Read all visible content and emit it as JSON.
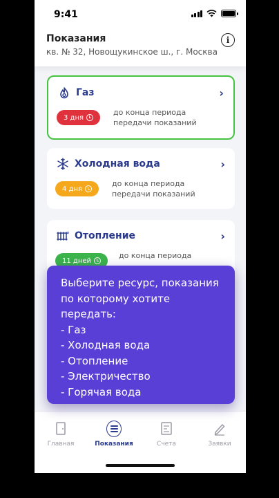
{
  "status_bar": {
    "time": "9:41"
  },
  "header": {
    "title": "Показания",
    "address": "кв. № 32, Новощукинское ш., г. Москва"
  },
  "cards": [
    {
      "title": "Газ",
      "badge": "3 дня",
      "badge_color": "#e0323c",
      "deadline": "до конца периода передачи показаний"
    },
    {
      "title": "Холодная вода",
      "badge": "4 дня",
      "badge_color": "#f6a81c",
      "deadline": "до конца периода передачи показаний"
    },
    {
      "title": "Отопление",
      "badge": "11 дней",
      "badge_color": "#3cb44b",
      "deadline": "до конца периода"
    }
  ],
  "tooltip": {
    "intro": "Выберите ресурс, показания по которому хотите передать:",
    "items": [
      "- Газ",
      "- Холодная вода",
      "- Отопление",
      "- Электричество",
      "- Горячая вода"
    ]
  },
  "tabs": [
    {
      "label": "Главная",
      "icon": "door-icon"
    },
    {
      "label": "Показания",
      "icon": "meter-icon",
      "active": true
    },
    {
      "label": "Счета",
      "icon": "bill-icon"
    },
    {
      "label": "Заявки",
      "icon": "pencil-icon"
    }
  ],
  "colors": {
    "accent": "#2a3a8c",
    "tooltip": "#5a3fd6",
    "selected_border": "#44c240"
  }
}
